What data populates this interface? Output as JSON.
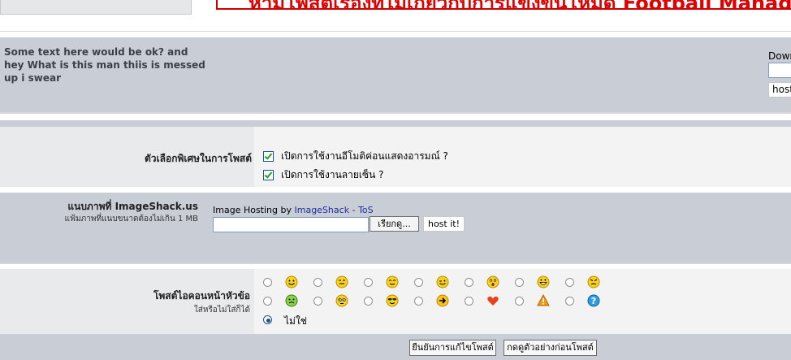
{
  "header": {
    "banner_text": "ห้ามโพสต์เรื่องที่ไม่เกี่ยวกับการแข่งขันโหมด Football Manager"
  },
  "post": {
    "body_text": "Some text here would be ok? and hey What is this man thiis is messed up i swear",
    "right_label": "Down",
    "right_button": "host"
  },
  "options": {
    "label": "ตัวเลือกพิเศษในการโพสต์",
    "check1": "เปิดการใช้งานอีโมติค่อนแสดงอารมณ์ ?",
    "check2": "เปิดการใช้งานลายเซ็น ?"
  },
  "imageshack": {
    "label": "แนบภาพที่ ImageShack.us",
    "sub": "แฟ้มภาพที่แนบขนาดต้องไม่เกิน 1 MB",
    "hosting_prefix": "Image Hosting by",
    "link1": "ImageShack",
    "sep": "-",
    "link2": "ToS",
    "browse_label": "เรียกดู...",
    "host_label": "host it!"
  },
  "icons": {
    "label": "โพสต์ไอคอนหน้าหัวข้อ",
    "sub": "ใส่หรือไม่ใส่ก็ได้",
    "none_label": "ไม่ใช่",
    "row1": [
      "smile-icon",
      "frown-icon",
      "cool-icon",
      "wink-icon",
      "surprised-icon",
      "biggrin-icon",
      "mad-icon"
    ],
    "row2": [
      "sick-icon",
      "sad-icon",
      "sunglasses-icon",
      "arrow-right-icon",
      "heart-icon",
      "exclamation-icon",
      "question-icon"
    ]
  },
  "buttons": {
    "submit": "ยืนยันการแก้ไขโพสต์",
    "preview": "กดดูตัวอย่างก่อนโพสต์"
  }
}
